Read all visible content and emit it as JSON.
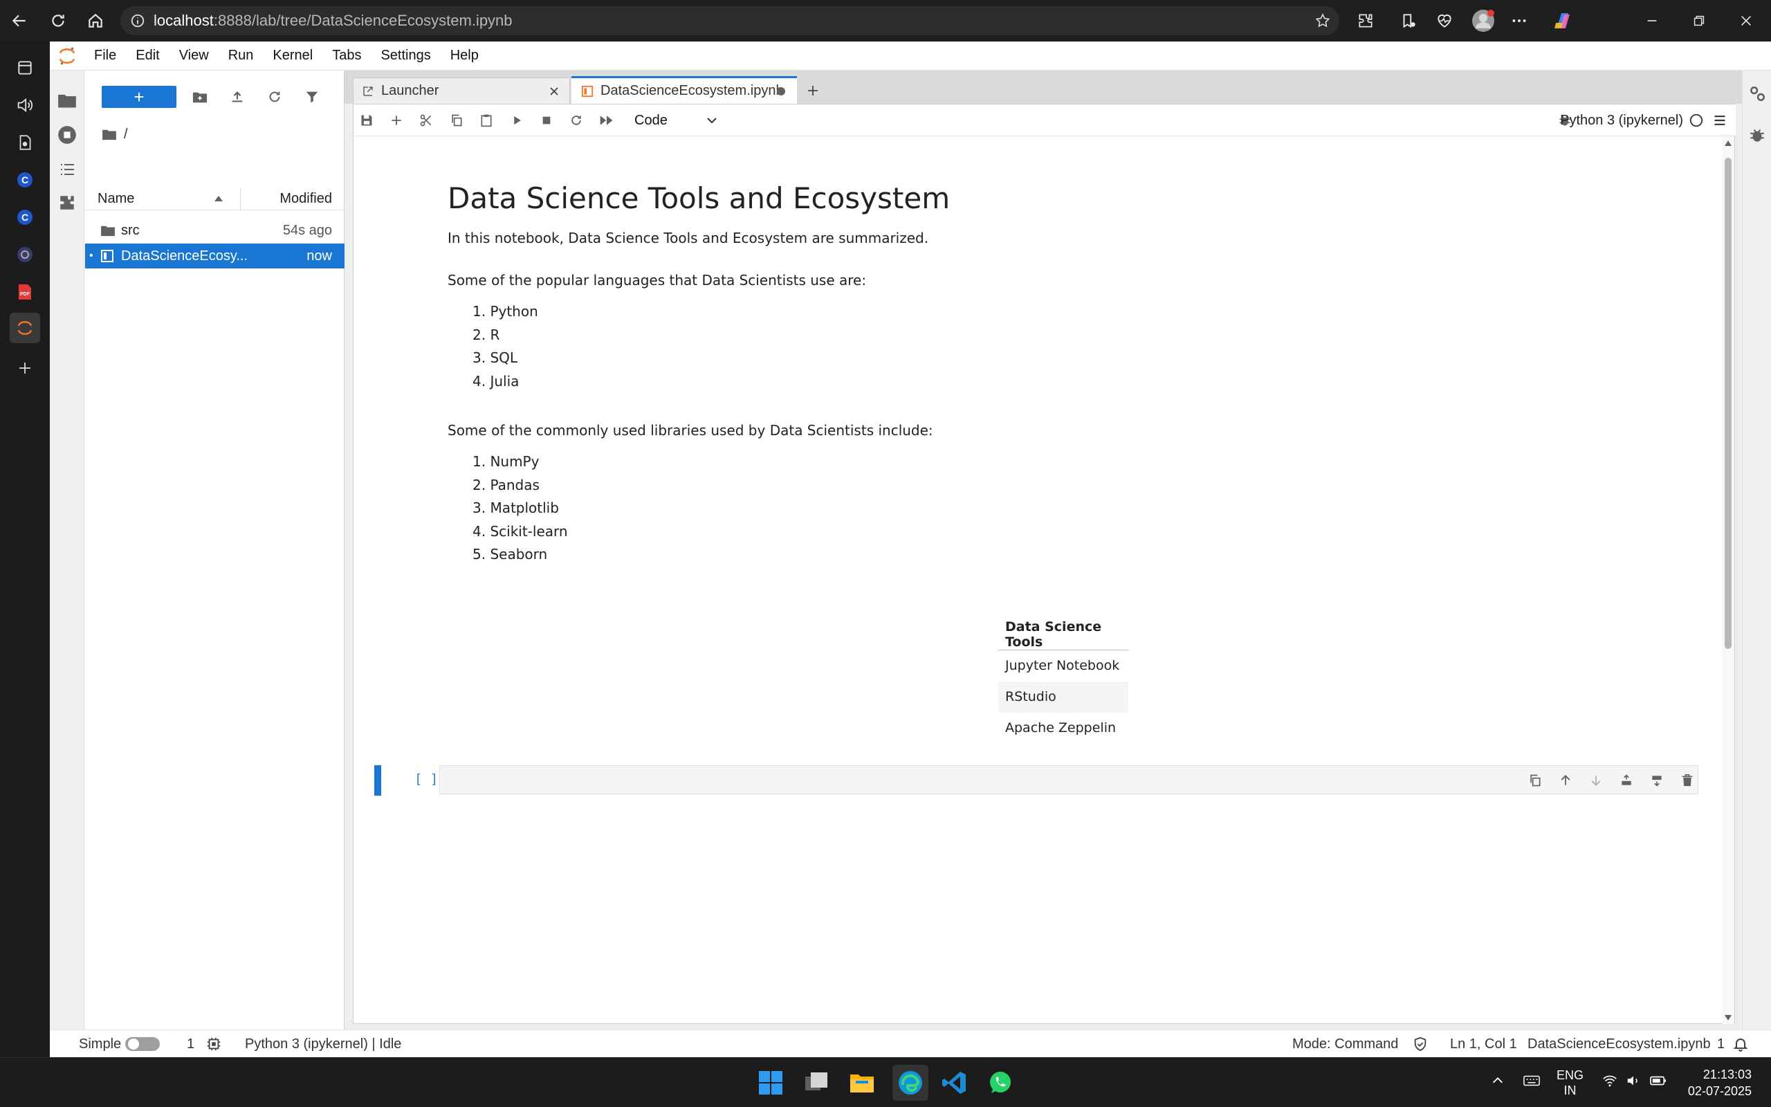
{
  "browser": {
    "url_host": "localhost",
    "url_path": ":8888/lab/tree/DataScienceEcosystem.ipynb"
  },
  "menu": [
    "File",
    "Edit",
    "View",
    "Run",
    "Kernel",
    "Tabs",
    "Settings",
    "Help"
  ],
  "filebrowser": {
    "new_label": "+",
    "breadcrumb": "/",
    "col_name": "Name",
    "col_modified": "Modified",
    "rows": [
      {
        "name": "src",
        "modified": "54s ago"
      },
      {
        "name": "DataScienceEcosy...",
        "modified": "now"
      }
    ]
  },
  "tabs": {
    "launcher": "Launcher",
    "notebook": "DataScienceEcosystem.ipynb"
  },
  "toolbar": {
    "cell_type": "Code",
    "kernel": "Python 3 (ipykernel)"
  },
  "notebook": {
    "title": "Data Science Tools and Ecosystem",
    "intro": "In this notebook, Data Science Tools and Ecosystem are summarized.",
    "languages_intro": "Some of the popular languages that Data Scientists use are:",
    "languages": [
      "1. Python",
      "2. R",
      "3. SQL",
      "4. Julia"
    ],
    "libraries_intro": "Some of the commonly used libraries used by Data Scientists include:",
    "libraries": [
      "1. NumPy",
      "2. Pandas",
      "3. Matplotlib",
      "4. Scikit-learn",
      "5. Seaborn"
    ],
    "table": {
      "header": "Data Science Tools",
      "rows": [
        "Jupyter Notebook",
        "RStudio",
        "Apache Zeppelin"
      ]
    },
    "code_prompt": "[ ]:"
  },
  "statusbar": {
    "mode_label": "Simple",
    "terminal_count": "1",
    "kernel_status": "Python 3 (ipykernel) | Idle",
    "mode": "Mode: Command",
    "cursor": "Ln 1, Col 1",
    "filename": "DataScienceEcosystem.ipynb",
    "notifications": "1"
  },
  "taskbar": {
    "lang_line1": "ENG",
    "lang_line2": "IN",
    "time": "21:13:03",
    "date": "02-07-2025"
  },
  "colors": {
    "accent": "#1976d2",
    "jupyter_orange": "#f37726"
  }
}
